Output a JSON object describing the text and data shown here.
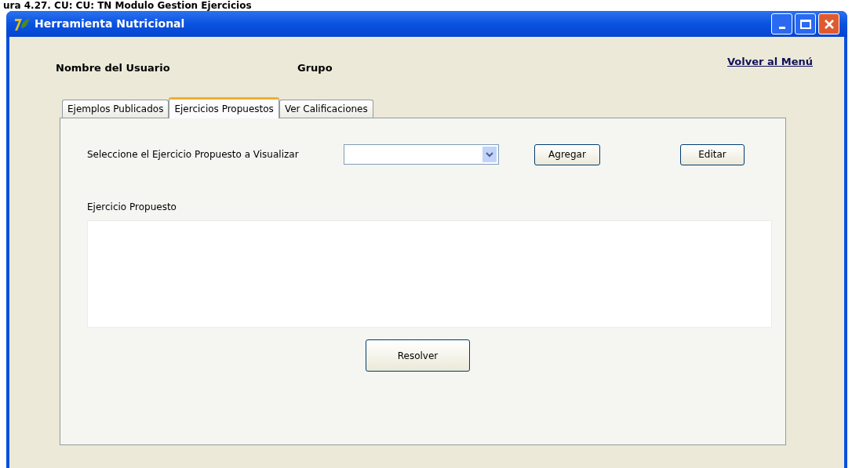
{
  "caption": "ura 4.27. CU: CU: TN Modulo Gestion Ejercicios",
  "window": {
    "title": "Herramienta Nutricional"
  },
  "header": {
    "user_label": "Nombre del Usuario",
    "group_label": "Grupo",
    "back_link": "Volver al Menú"
  },
  "tabs": [
    {
      "label": "Ejemplos Publicados",
      "selected": false
    },
    {
      "label": "Ejercicios Propuestos",
      "selected": true
    },
    {
      "label": "Ver Calificaciones",
      "selected": false
    }
  ],
  "panel": {
    "select_label": "Seleccione el Ejercicio Propuesto a Visualizar",
    "buttons": [
      "Agregar",
      "Editar"
    ],
    "exercise_label": "Ejercicio Propuesto",
    "solve_button": "Resolver"
  }
}
